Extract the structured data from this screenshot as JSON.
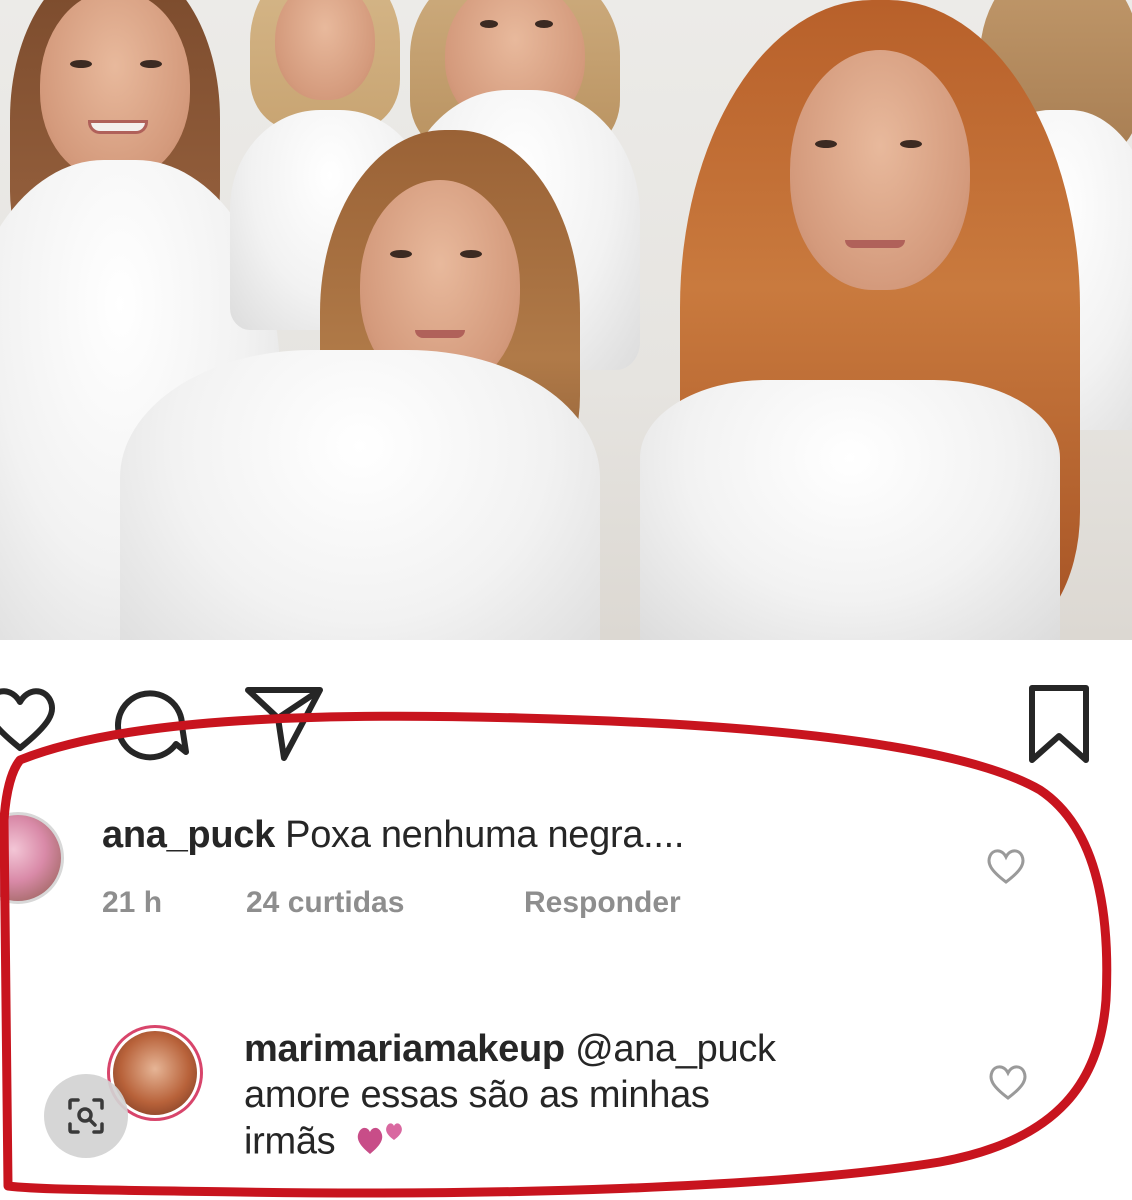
{
  "post": {
    "photo_alt": "",
    "actions": {
      "like_icon": "heart-icon",
      "comment_icon": "comment-bubble-icon",
      "share_icon": "paper-plane-icon",
      "save_icon": "bookmark-icon"
    }
  },
  "comments": [
    {
      "username": "ana_puck",
      "text": "Poxa nenhuma negra....",
      "time": "21 h",
      "likes": "24 curtidas",
      "reply_label": "Responder"
    },
    {
      "username": "marimariamakeup",
      "mention": "@ana_puck",
      "text_line2": "amore essas são as minhas",
      "text_line3": "irmãs"
    }
  ],
  "colors": {
    "annotation_red": "#c8141e",
    "meta_gray": "#8e8e8e",
    "text_dark": "#262626"
  },
  "overlay": {
    "lens_icon": "visual-search-icon"
  }
}
